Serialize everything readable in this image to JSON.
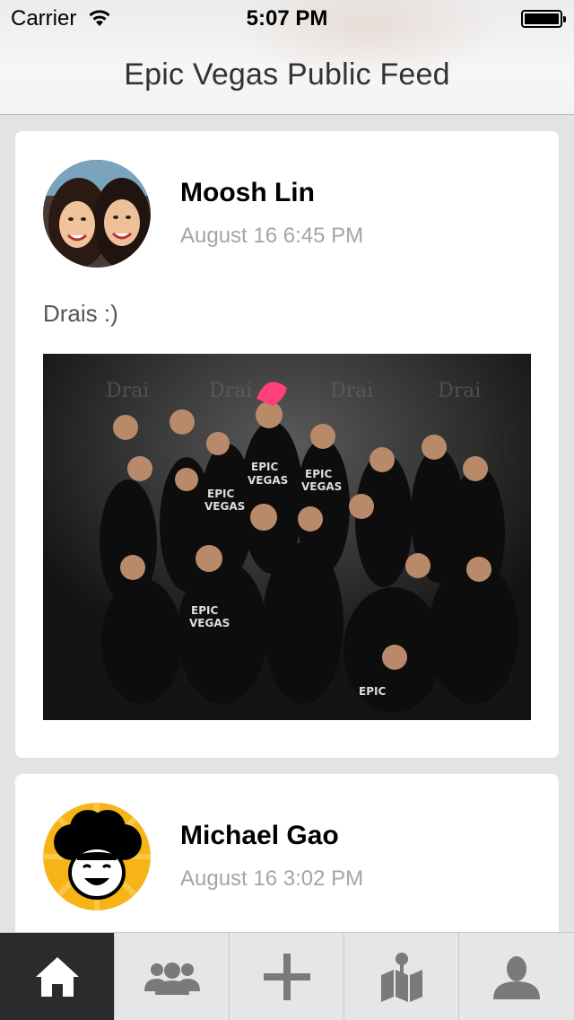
{
  "status_bar": {
    "carrier": "Carrier",
    "time": "5:07 PM",
    "icons": [
      "wifi-icon",
      "battery-icon"
    ]
  },
  "nav": {
    "title": "Epic Vegas Public Feed"
  },
  "feed": [
    {
      "author": "Moosh Lin",
      "date": "August 16 6:45 PM",
      "caption": "Drais :)",
      "has_photo": true
    },
    {
      "author": "Michael Gao",
      "date": "August 16 3:02 PM"
    }
  ],
  "tabbar": {
    "active": "home",
    "tabs": [
      {
        "icon": "home-icon"
      },
      {
        "icon": "group-icon"
      },
      {
        "icon": "plus-icon"
      },
      {
        "icon": "map-icon"
      },
      {
        "icon": "profile-icon"
      }
    ]
  },
  "colors": {
    "background": "#e3e3e3",
    "card": "#ffffff",
    "date_text": "#a5a5a5",
    "tab_active": "#2b2b2b",
    "tab_icon": "#7a7a7a",
    "avatar2_yellow": "#f6b417"
  }
}
